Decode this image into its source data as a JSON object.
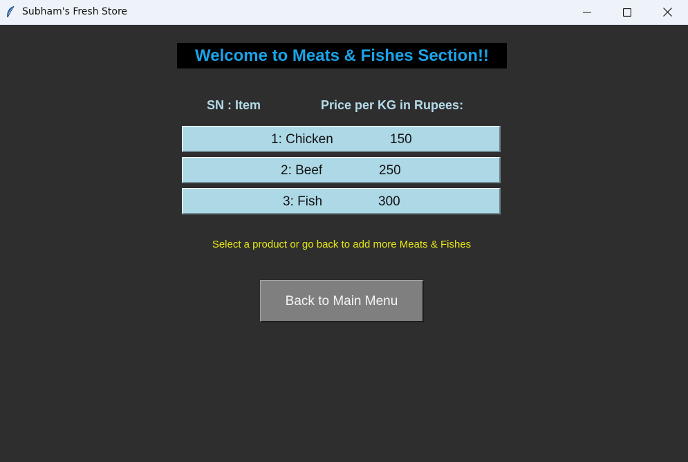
{
  "window": {
    "title": "Subham's Fresh Store",
    "icon": "feather-icon",
    "controls": [
      "minimize-icon",
      "maximize-icon",
      "close-icon"
    ]
  },
  "section": {
    "heading": "Welcome to Meats & Fishes Section!!",
    "col_sn": "SN : Item",
    "col_price": "Price per KG in Rupees:"
  },
  "items": [
    {
      "label": "1: Chicken",
      "price": "150"
    },
    {
      "label": "2: Beef",
      "price": "250"
    },
    {
      "label": "3: Fish",
      "price": "300"
    }
  ],
  "hint": "Select a product or go back to add more Meats & Fishes",
  "back_button": "Back to Main Menu",
  "colors": {
    "background": "#2e2e2e",
    "heading_text": "#1aa3e8",
    "item_button": "#add8e6",
    "hint_text": "#e6e617",
    "back_button": "#7f7f7f"
  }
}
